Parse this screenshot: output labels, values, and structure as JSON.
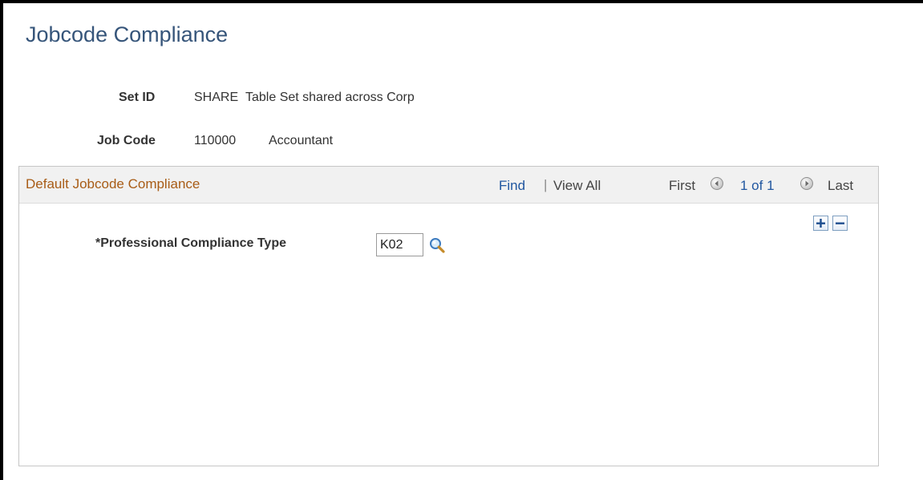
{
  "page": {
    "title": "Jobcode Compliance"
  },
  "fields": {
    "setid": {
      "label": "Set ID",
      "value": "SHARE",
      "description": "Table Set shared across Corp"
    },
    "jobcode": {
      "label": "Job Code",
      "value": "110000",
      "description": "Accountant"
    }
  },
  "group": {
    "title": "Default Jobcode Compliance",
    "nav": {
      "find": "Find",
      "separator": "|",
      "view_all": "View All",
      "first": "First",
      "position": "1 of 1",
      "last": "Last"
    },
    "row_actions": {
      "add_icon": "plus-icon",
      "delete_icon": "minus-icon"
    },
    "compliance_type": {
      "label": "*Professional Compliance Type",
      "value": "K02",
      "lookup_icon": "search-icon"
    }
  },
  "colors": {
    "title": "#36557a",
    "group_title": "#a85c16",
    "link": "#2157a0",
    "header_bg": "#f1f1f1"
  }
}
